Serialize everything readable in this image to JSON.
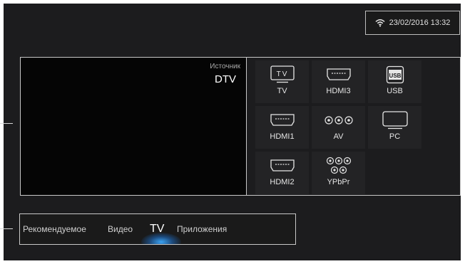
{
  "status": {
    "wifi_icon": "wifi-icon",
    "datetime": "23/02/2016 13:32"
  },
  "preview": {
    "source_label": "Источник",
    "source_value": "DTV"
  },
  "inputs": [
    {
      "label": "TV",
      "icon": "tv-icon"
    },
    {
      "label": "HDMI3",
      "icon": "hdmi-icon"
    },
    {
      "label": "USB",
      "icon": "usb-icon"
    },
    {
      "label": "HDMI1",
      "icon": "hdmi-icon"
    },
    {
      "label": "AV",
      "icon": "av-icon"
    },
    {
      "label": "PC",
      "icon": "pc-icon"
    },
    {
      "label": "HDMI2",
      "icon": "hdmi-icon"
    },
    {
      "label": "YPbPr",
      "icon": "ypbpr-icon"
    }
  ],
  "icon_glyphs": {
    "tv_text": "TV",
    "usb_text": "USB"
  },
  "nav": {
    "items": [
      "Рекомендуемое",
      "Видео",
      "TV",
      "Приложения"
    ],
    "active": "TV"
  },
  "colors": {
    "background": "#1c1c1e",
    "accent_glow": "#3caaff"
  }
}
